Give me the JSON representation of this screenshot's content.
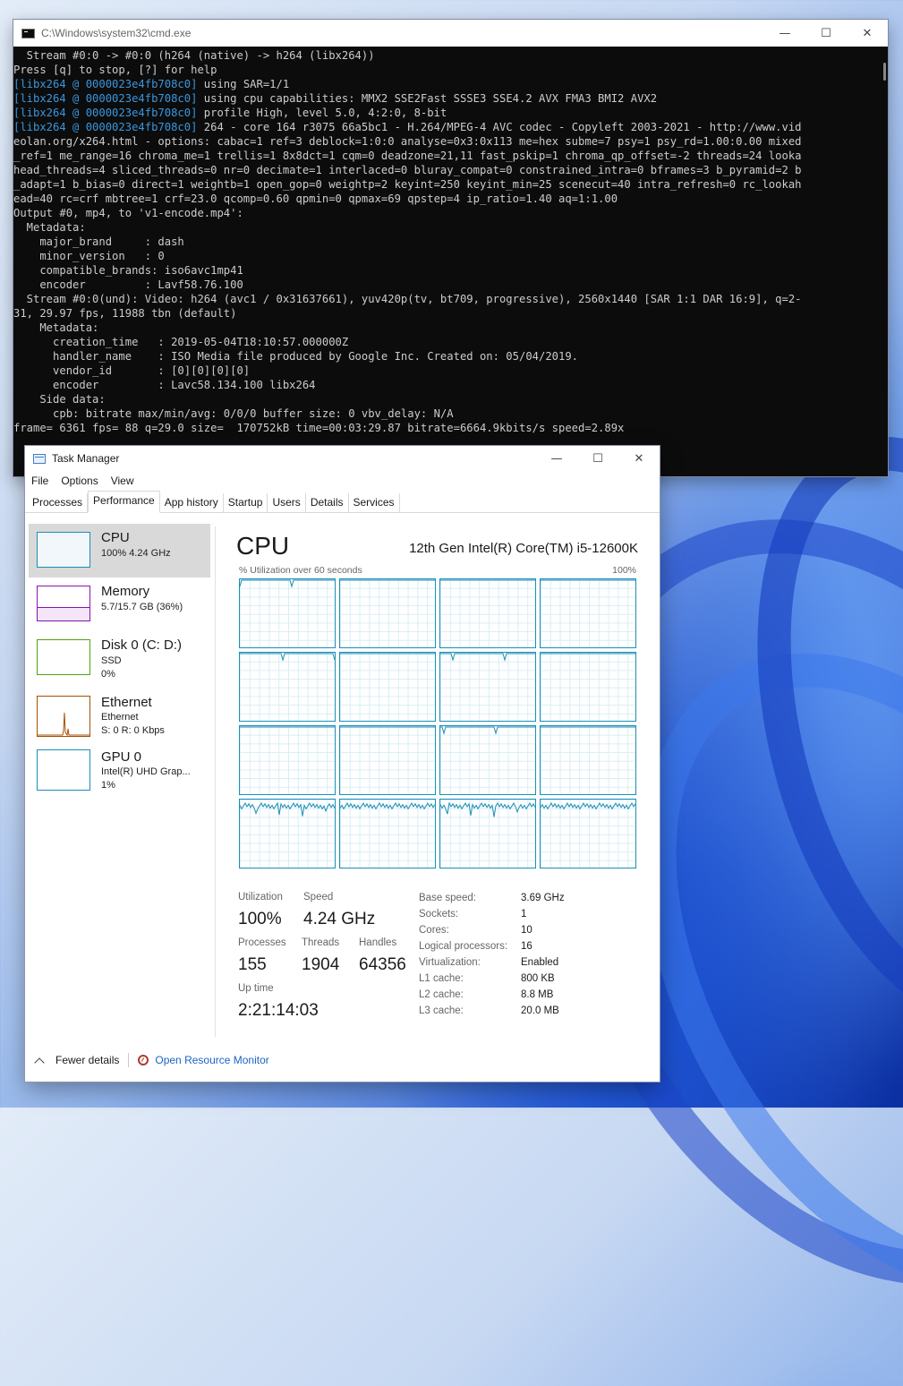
{
  "cmd": {
    "title": "C:\\Windows\\system32\\cmd.exe",
    "lines": [
      {
        "tag": "",
        "text": "  Stream #0:0 -> #0:0 (h264 (native) -> h264 (libx264))"
      },
      {
        "tag": "",
        "text": "Press [q] to stop, [?] for help"
      },
      {
        "tag": "[libx264 @ 0000023e4fb708c0]",
        "text": " using SAR=1/1"
      },
      {
        "tag": "[libx264 @ 0000023e4fb708c0]",
        "text": " using cpu capabilities: MMX2 SSE2Fast SSSE3 SSE4.2 AVX FMA3 BMI2 AVX2"
      },
      {
        "tag": "[libx264 @ 0000023e4fb708c0]",
        "text": " profile High, level 5.0, 4:2:0, 8-bit"
      },
      {
        "tag": "[libx264 @ 0000023e4fb708c0]",
        "text": " 264 - core 164 r3075 66a5bc1 - H.264/MPEG-4 AVC codec - Copyleft 2003-2021 - http://www.vid"
      },
      {
        "tag": "",
        "text": "eolan.org/x264.html - options: cabac=1 ref=3 deblock=1:0:0 analyse=0x3:0x113 me=hex subme=7 psy=1 psy_rd=1.00:0.00 mixed"
      },
      {
        "tag": "",
        "text": "_ref=1 me_range=16 chroma_me=1 trellis=1 8x8dct=1 cqm=0 deadzone=21,11 fast_pskip=1 chroma_qp_offset=-2 threads=24 looka"
      },
      {
        "tag": "",
        "text": "head_threads=4 sliced_threads=0 nr=0 decimate=1 interlaced=0 bluray_compat=0 constrained_intra=0 bframes=3 b_pyramid=2 b"
      },
      {
        "tag": "",
        "text": "_adapt=1 b_bias=0 direct=1 weightb=1 open_gop=0 weightp=2 keyint=250 keyint_min=25 scenecut=40 intra_refresh=0 rc_lookah"
      },
      {
        "tag": "",
        "text": "ead=40 rc=crf mbtree=1 crf=23.0 qcomp=0.60 qpmin=0 qpmax=69 qpstep=4 ip_ratio=1.40 aq=1:1.00"
      },
      {
        "tag": "",
        "text": "Output #0, mp4, to 'v1-encode.mp4':"
      },
      {
        "tag": "",
        "text": "  Metadata:"
      },
      {
        "tag": "",
        "text": "    major_brand     : dash"
      },
      {
        "tag": "",
        "text": "    minor_version   : 0"
      },
      {
        "tag": "",
        "text": "    compatible_brands: iso6avc1mp41"
      },
      {
        "tag": "",
        "text": "    encoder         : Lavf58.76.100"
      },
      {
        "tag": "",
        "text": "  Stream #0:0(und): Video: h264 (avc1 / 0x31637661), yuv420p(tv, bt709, progressive), 2560x1440 [SAR 1:1 DAR 16:9], q=2-"
      },
      {
        "tag": "",
        "text": "31, 29.97 fps, 11988 tbn (default)"
      },
      {
        "tag": "",
        "text": "    Metadata:"
      },
      {
        "tag": "",
        "text": "      creation_time   : 2019-05-04T18:10:57.000000Z"
      },
      {
        "tag": "",
        "text": "      handler_name    : ISO Media file produced by Google Inc. Created on: 05/04/2019."
      },
      {
        "tag": "",
        "text": "      vendor_id       : [0][0][0][0]"
      },
      {
        "tag": "",
        "text": "      encoder         : Lavc58.134.100 libx264"
      },
      {
        "tag": "",
        "text": "    Side data:"
      },
      {
        "tag": "",
        "text": "      cpb: bitrate max/min/avg: 0/0/0 buffer size: 0 vbv_delay: N/A"
      },
      {
        "tag": "",
        "text": "frame= 6361 fps= 88 q=29.0 size=  170752kB time=00:03:29.87 bitrate=6664.9kbits/s speed=2.89x"
      }
    ]
  },
  "taskmanager": {
    "title": "Task Manager",
    "menu": [
      "File",
      "Options",
      "View"
    ],
    "tabs": [
      "Processes",
      "Performance",
      "App history",
      "Startup",
      "Users",
      "Details",
      "Services"
    ],
    "active_tab": "Performance",
    "sidebar": [
      {
        "name": "CPU",
        "sub1": "100%  4.24 GHz",
        "sub2": "",
        "sub3": "",
        "color": "#1b8fb6"
      },
      {
        "name": "Memory",
        "sub1": "5.7/15.7 GB (36%)",
        "sub2": "",
        "sub3": "",
        "color": "#8b12ae"
      },
      {
        "name": "Disk 0 (C: D:)",
        "sub1": "SSD",
        "sub2": "0%",
        "sub3": "",
        "color": "#4da60c"
      },
      {
        "name": "Ethernet",
        "sub1": "Ethernet",
        "sub2": "S: 0  R: 0 Kbps",
        "sub3": "",
        "color": "#a74f01"
      },
      {
        "name": "GPU 0",
        "sub1": "Intel(R) UHD Grap...",
        "sub2": "1%",
        "sub3": "",
        "color": "#1b8fb6"
      }
    ],
    "cpu": {
      "heading": "CPU",
      "model": "12th Gen Intel(R) Core(TM) i5-12600K",
      "graph_label": "% Utilization over 60 seconds",
      "graph_max": "100%",
      "stats": {
        "utilization_label": "Utilization",
        "utilization": "100%",
        "speed_label": "Speed",
        "speed": "4.24 GHz",
        "processes_label": "Processes",
        "processes": "155",
        "threads_label": "Threads",
        "threads": "1904",
        "handles_label": "Handles",
        "handles": "64356",
        "uptime_label": "Up time",
        "uptime": "2:21:14:03"
      },
      "specs": [
        {
          "label": "Base speed:",
          "value": "3.69 GHz"
        },
        {
          "label": "Sockets:",
          "value": "1"
        },
        {
          "label": "Cores:",
          "value": "10"
        },
        {
          "label": "Logical processors:",
          "value": "16"
        },
        {
          "label": "Virtualization:",
          "value": "Enabled"
        },
        {
          "label": "L1 cache:",
          "value": "800 KB"
        },
        {
          "label": "L2 cache:",
          "value": "8.8 MB"
        },
        {
          "label": "L3 cache:",
          "value": "20.0 MB"
        }
      ]
    },
    "footer": {
      "fewer_details": "Fewer details",
      "open_resource_monitor": "Open Resource Monitor"
    }
  }
}
